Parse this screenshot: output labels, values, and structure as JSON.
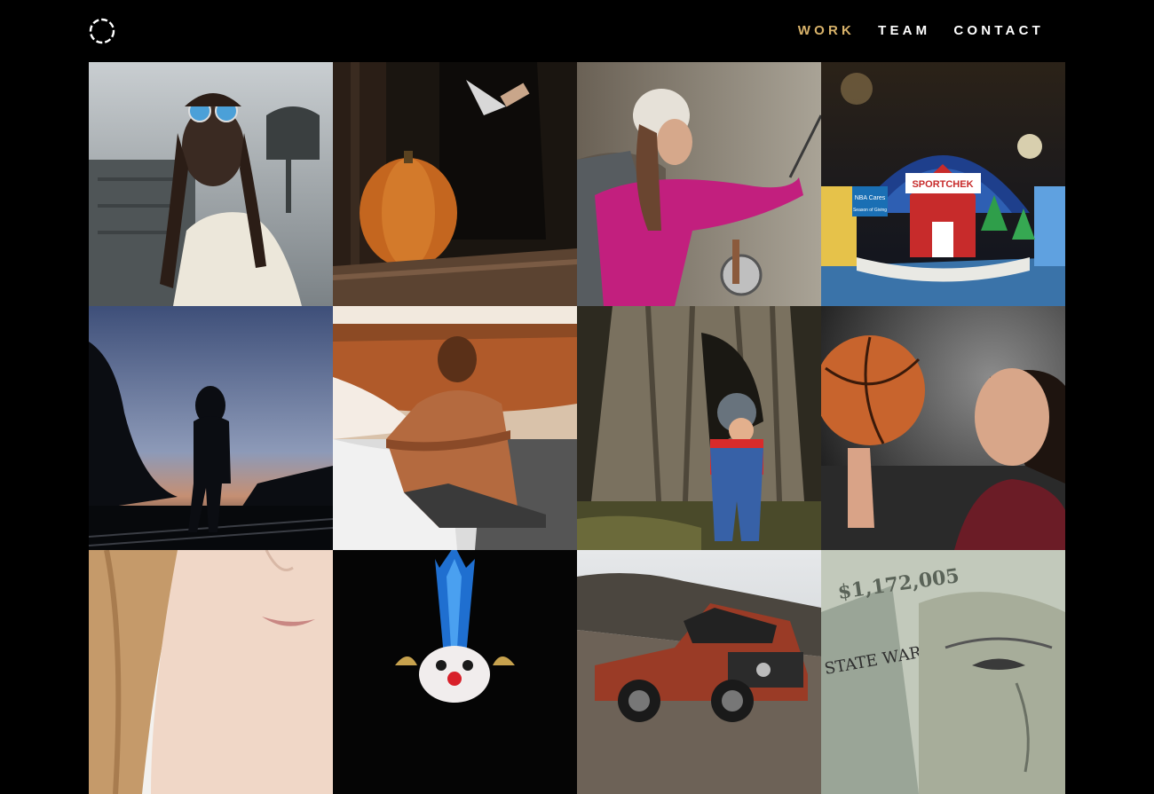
{
  "header": {
    "logo_icon": "dashed-ring-icon",
    "nav": [
      {
        "label": "WORK",
        "active": true
      },
      {
        "label": "TEAM",
        "active": false
      },
      {
        "label": "CONTACT",
        "active": false
      }
    ]
  },
  "accent_color": "#d8b26a",
  "grid": {
    "tiles": [
      {
        "subject": "woman-with-sunglasses-and-braids"
      },
      {
        "subject": "pumpkin-and-knife"
      },
      {
        "subject": "woman-fly-fishing"
      },
      {
        "subject": "sportchek-holiday-popup-book",
        "texts": [
          "SPORTCHEK",
          "NBA Cares",
          "Season of Giving"
        ]
      },
      {
        "subject": "person-walking-on-railroad-tracks"
      },
      {
        "subject": "man-sitting-on-beach"
      },
      {
        "subject": "toddler-at-tree-trunk"
      },
      {
        "subject": "woman-spinning-basketball"
      },
      {
        "subject": "blonde-woman-portrait"
      },
      {
        "subject": "clown-with-blue-hair"
      },
      {
        "subject": "red-pickup-truck"
      },
      {
        "subject": "hundred-dollar-bill-franklin",
        "texts": [
          "$1,172,005",
          "STATE WAR"
        ]
      }
    ]
  }
}
